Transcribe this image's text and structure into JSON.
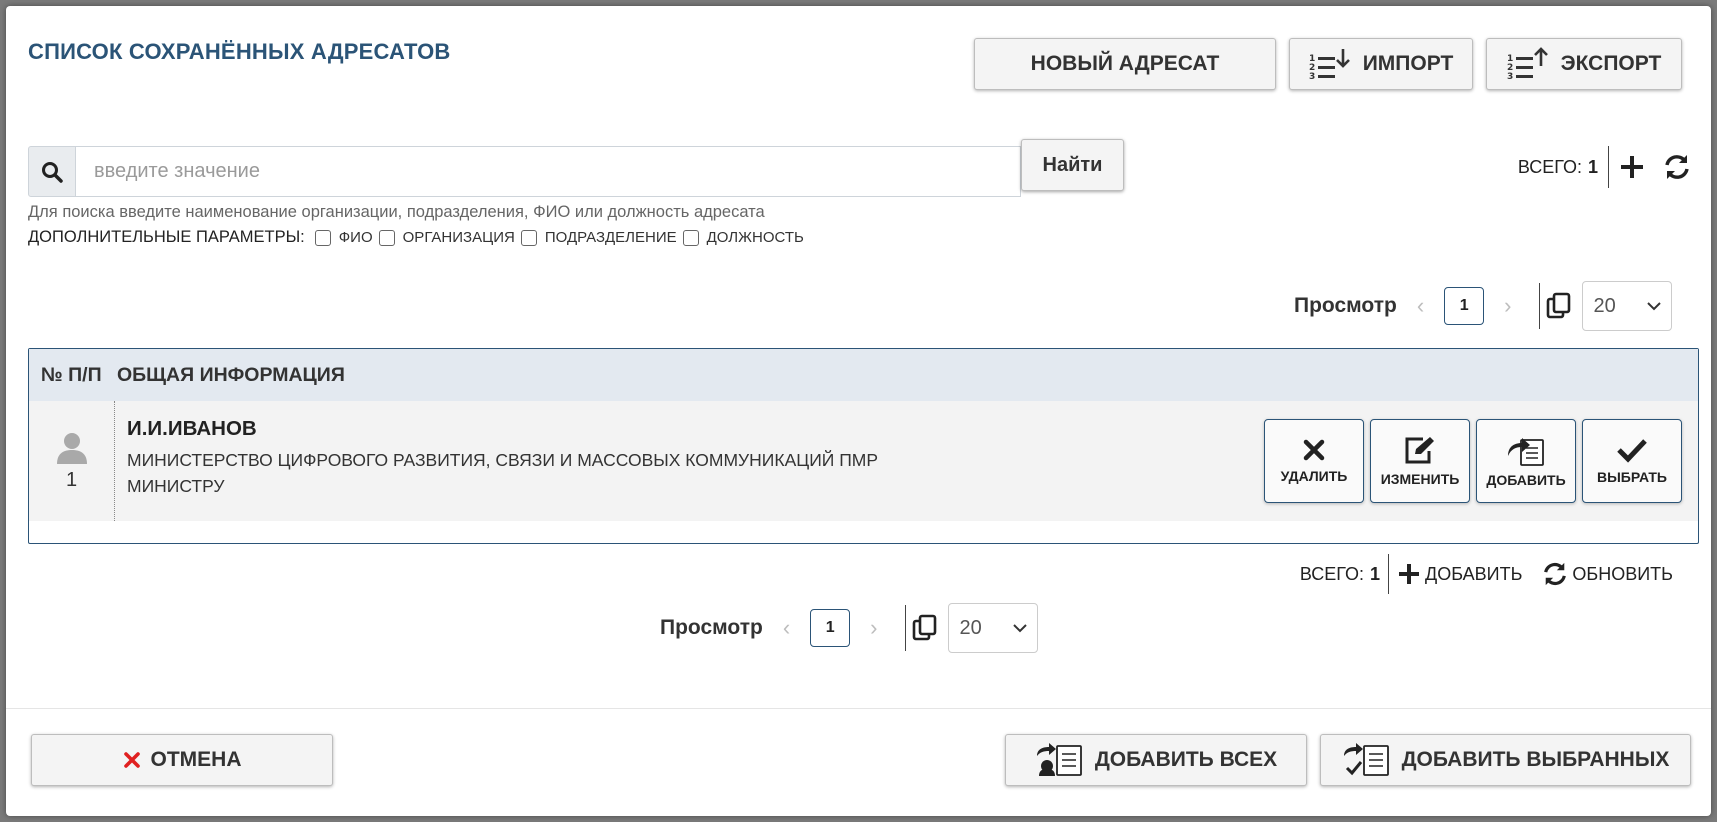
{
  "dialog": {
    "title": "СПИСОК СОХРАНЁННЫХ АДРЕСАТОВ"
  },
  "toolbar": {
    "new_label": "НОВЫЙ АДРЕСАТ",
    "import_label": "ИМПОРТ",
    "export_label": "ЭКСПОРТ"
  },
  "search": {
    "placeholder": "введите значение",
    "value": "",
    "button_label": "Найти",
    "hint": "Для поиска введите наименование организации, подразделения, ФИО или должность адресата",
    "params_label": "ДОПОЛНИТЕЛЬНЫЕ ПАРАМЕТРЫ:",
    "params": [
      {
        "label": "ФИО",
        "checked": false
      },
      {
        "label": "ОРГАНИЗАЦИЯ",
        "checked": false
      },
      {
        "label": "ПОДРАЗДЕЛЕНИЕ",
        "checked": false
      },
      {
        "label": "ДОЛЖНОСТЬ",
        "checked": false
      }
    ]
  },
  "summary": {
    "total_label": "ВСЕГО:",
    "total_value": "1",
    "add_label": "ДОБАВИТЬ",
    "refresh_label": "ОБНОВИТЬ"
  },
  "pager": {
    "label": "Просмотр",
    "current_page": "1",
    "page_size": "20"
  },
  "table": {
    "columns": [
      "№ П/П",
      "ОБЩАЯ ИНФОРМАЦИЯ"
    ],
    "rows": [
      {
        "num": "1",
        "name": "И.И.ИВАНОВ",
        "organization": "МИНИСТЕРСТВО ЦИФРОВОГО РАЗВИТИЯ, СВЯЗИ И МАССОВЫХ КОММУНИКАЦИЙ ПМР",
        "position": "МИНИСТРУ",
        "actions": {
          "delete": "УДАЛИТЬ",
          "edit": "ИЗМЕНИТЬ",
          "add": "ДОБАВИТЬ",
          "select": "ВЫБРАТЬ"
        }
      }
    ]
  },
  "footer": {
    "cancel_label": "ОТМЕНА",
    "add_all_label": "ДОБАВИТЬ ВСЕХ",
    "add_selected_label": "ДОБАВИТЬ ВЫБРАННЫХ"
  },
  "colors": {
    "accent": "#2b5477",
    "header_bg": "#e3e9f0",
    "row_bg": "#f3f3f3",
    "cancel_icon": "#e02020"
  },
  "icons": [
    "search-icon",
    "import-icon",
    "export-icon",
    "plus-icon",
    "refresh-icon",
    "copy-icon",
    "chevron-down-icon",
    "user-icon",
    "close-icon",
    "edit-icon",
    "share-doc-icon",
    "check-icon"
  ]
}
